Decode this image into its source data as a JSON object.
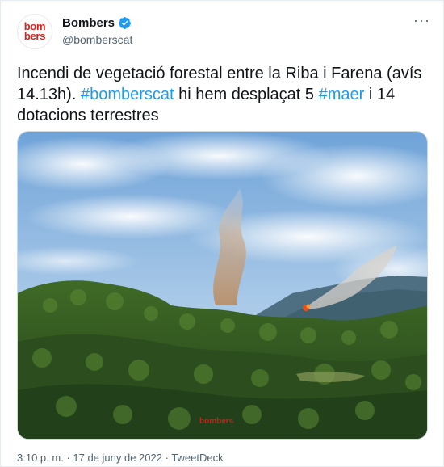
{
  "author": {
    "avatar_line1": "bom",
    "avatar_line2": "bers",
    "display_name": "Bombers",
    "handle": "@bomberscat",
    "verified": true
  },
  "more_icon": "···",
  "tweet": {
    "text_1": "Incendi de vegetació forestal entre la Riba i Farena (avís 14.13h). ",
    "hashtag_1": "#bomberscat",
    "text_2": " hi hem desplaçat 5 ",
    "hashtag_2": "#maer",
    "text_3": " i 14 dotacions terrestres"
  },
  "media": {
    "watermark": "bombers"
  },
  "footer": {
    "time": "3:10 p. m.",
    "separator_1": " · ",
    "date": "17 de juny de 2022",
    "separator_2": " · ",
    "source": "TweetDeck"
  },
  "colors": {
    "link": "#1d9bf0",
    "brand_red": "#d8231c",
    "muted": "#536471"
  }
}
